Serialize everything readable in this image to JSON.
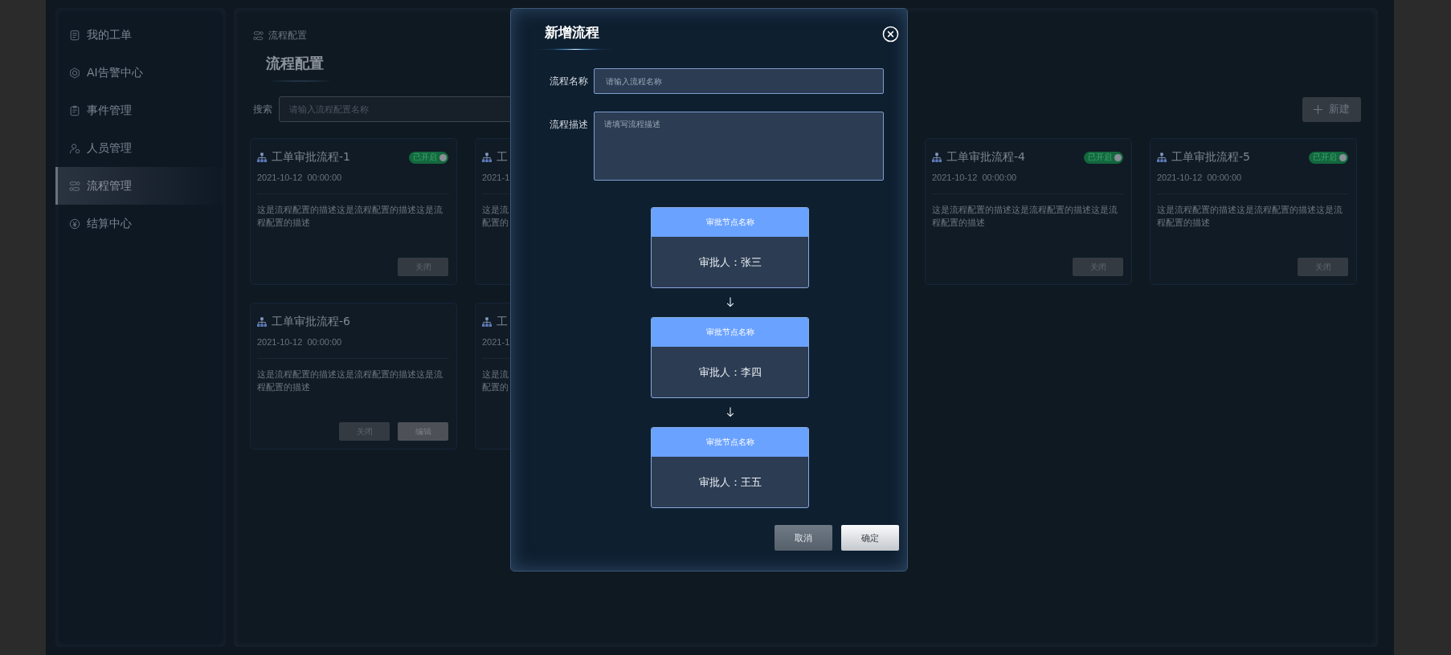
{
  "sidebar": {
    "items": [
      {
        "label": "我的工单",
        "selected": false
      },
      {
        "label": "AI告警中心",
        "selected": false
      },
      {
        "label": "事件管理",
        "selected": false
      },
      {
        "label": "人员管理",
        "selected": false
      },
      {
        "label": "流程管理",
        "selected": true
      },
      {
        "label": "结算中心",
        "selected": false
      }
    ]
  },
  "breadcrumb": "流程配置",
  "page_title": "流程配置",
  "search": {
    "label": "搜索",
    "placeholder": "请输入流程配置名称"
  },
  "new_button": "新建",
  "card_rows": [
    {
      "left": [
        {
          "kind": "full",
          "title": "工单审批流程-1",
          "status": {
            "label": "已开启",
            "on": true
          },
          "date": "2021-10-12  00:00:00",
          "description": "这是流程配置的描述这是流程配置的描述这是流程配置的描述",
          "buttons": [
            "关闭"
          ]
        },
        {
          "kind": "covered",
          "title": "工",
          "date": "2021-1",
          "lines": [
            "这是流",
            "配置的"
          ]
        }
      ],
      "right": [
        {
          "kind": "full",
          "title": "工单审批流程-4",
          "status": {
            "label": "已开启",
            "on": true
          },
          "date": "2021-10-12  00:00:00",
          "description": "这是流程配置的描述这是流程配置的描述这是流程配置的描述",
          "buttons": [
            "关闭"
          ]
        },
        {
          "kind": "full",
          "title": "工单审批流程-5",
          "status": {
            "label": "已开启",
            "on": true
          },
          "date": "2021-10-12  00:00:00",
          "description": "这是流程配置的描述这是流程配置的描述这是流程配置的描述",
          "buttons": [
            "关闭"
          ]
        }
      ]
    },
    {
      "left": [
        {
          "kind": "full",
          "title": "工单审批流程-6",
          "date": "2021-10-12  00:00:00",
          "description": "这是流程配置的描述这是流程配置的描述这是流程配置的描述",
          "buttons": [
            "关闭",
            "编辑"
          ]
        },
        {
          "kind": "covered",
          "title": "工",
          "date": "2021-1",
          "lines": [
            "这是流",
            "配置的"
          ]
        }
      ],
      "right": []
    }
  ],
  "dialog": {
    "title": "新增流程",
    "fields": [
      {
        "kind": "input",
        "label": "流程名称",
        "placeholder": "请输入流程名称"
      },
      {
        "kind": "textarea",
        "label": "流程描述",
        "placeholder": "请填写流程描述"
      }
    ],
    "nodes": [
      {
        "name": "审批节点名称",
        "approver": "审批人：张三"
      },
      {
        "name": "审批节点名称",
        "approver": "审批人：李四"
      },
      {
        "name": "审批节点名称",
        "approver": "审批人：王五"
      }
    ],
    "buttons": [
      {
        "kind": "secondary",
        "label": "取消"
      },
      {
        "kind": "primary",
        "label": "确定"
      }
    ]
  }
}
